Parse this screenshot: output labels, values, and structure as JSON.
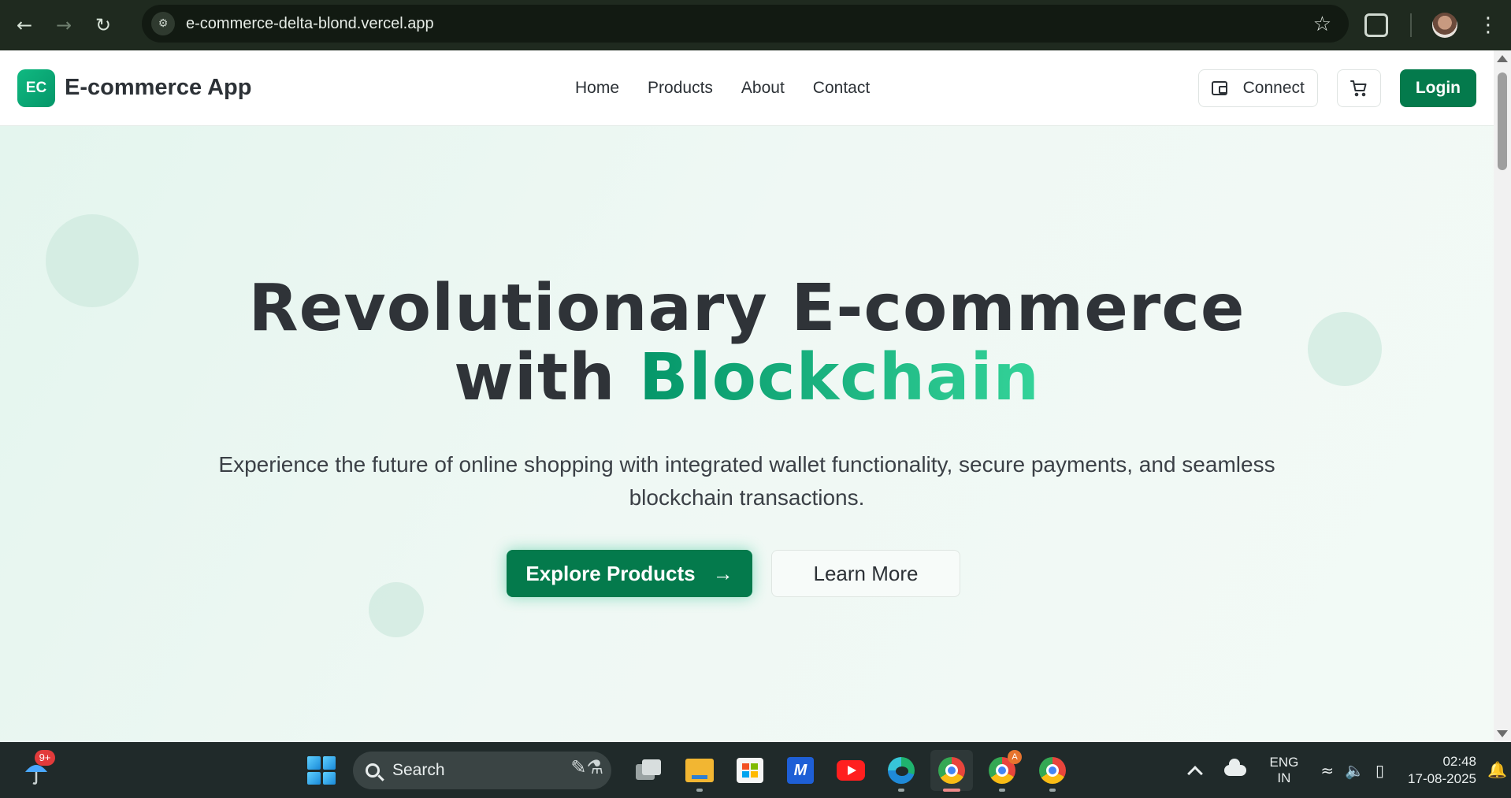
{
  "browser": {
    "url": "e-commerce-delta-blond.vercel.app"
  },
  "site": {
    "logo_badge": "EC",
    "logo_text": "E-commerce App",
    "nav": [
      {
        "label": "Home"
      },
      {
        "label": "Products"
      },
      {
        "label": "About"
      },
      {
        "label": "Contact"
      }
    ],
    "connect_label": "Connect",
    "login_label": "Login"
  },
  "hero": {
    "title_line1": "Revolutionary E-commerce",
    "title_line2_prefix": "with ",
    "title_line2_accent": "Blockchain",
    "subtitle": "Experience the future of online shopping with integrated wallet functionality, secure payments, and seamless blockchain transactions.",
    "primary_cta": "Explore Products",
    "primary_cta_icon": "→",
    "secondary_cta": "Learn More"
  },
  "taskbar": {
    "weather_badge": "9+",
    "search_placeholder": "Search",
    "chrome_profile_badge": "A",
    "language_line1": "ENG",
    "language_line2": "IN",
    "time": "02:48",
    "date": "17-08-2025"
  },
  "colors": {
    "brand_green": "#047a4c",
    "accent_gradient_start": "#059669",
    "accent_gradient_end": "#34d399",
    "hero_background": "#eef8f3",
    "chrome_background": "#1f2a1f",
    "taskbar_background": "#202a2a"
  }
}
